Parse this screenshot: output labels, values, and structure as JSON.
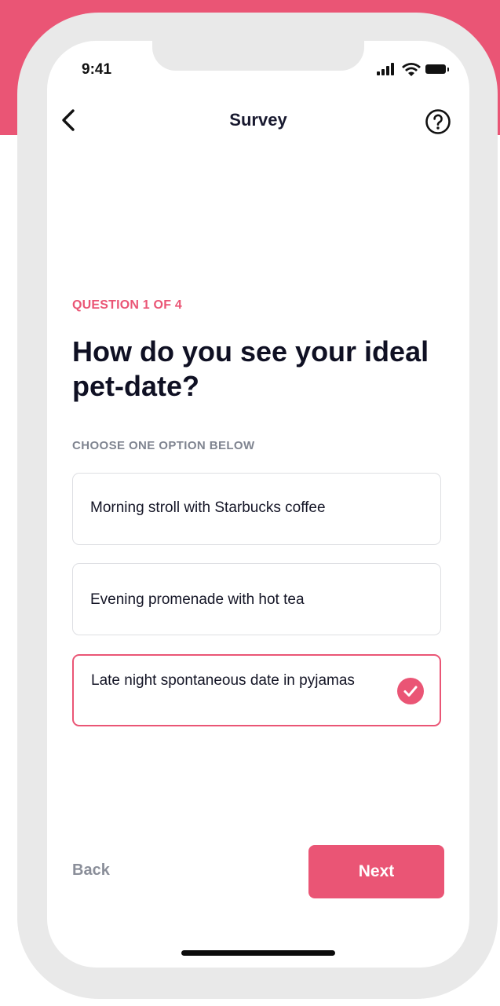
{
  "status_bar": {
    "time": "9:41"
  },
  "nav": {
    "title": "Survey",
    "back_icon": "chevron-left-icon",
    "help_icon": "question-circle-icon"
  },
  "question": {
    "counter": "QUESTION 1 OF 4",
    "title": "How do you see your ideal pet-date?",
    "instruction": "CHOOSE ONE OPTION BELOW"
  },
  "options": [
    {
      "label": "Morning stroll with Starbucks coffee",
      "selected": false
    },
    {
      "label": "Evening promenade with hot tea",
      "selected": false
    },
    {
      "label": "Late night spontaneous date in pyjamas",
      "selected": true
    }
  ],
  "footer": {
    "back_label": "Back",
    "next_label": "Next"
  },
  "colors": {
    "accent": "#ea5575",
    "text_dark": "#0f1023",
    "muted": "#8a8e99"
  }
}
